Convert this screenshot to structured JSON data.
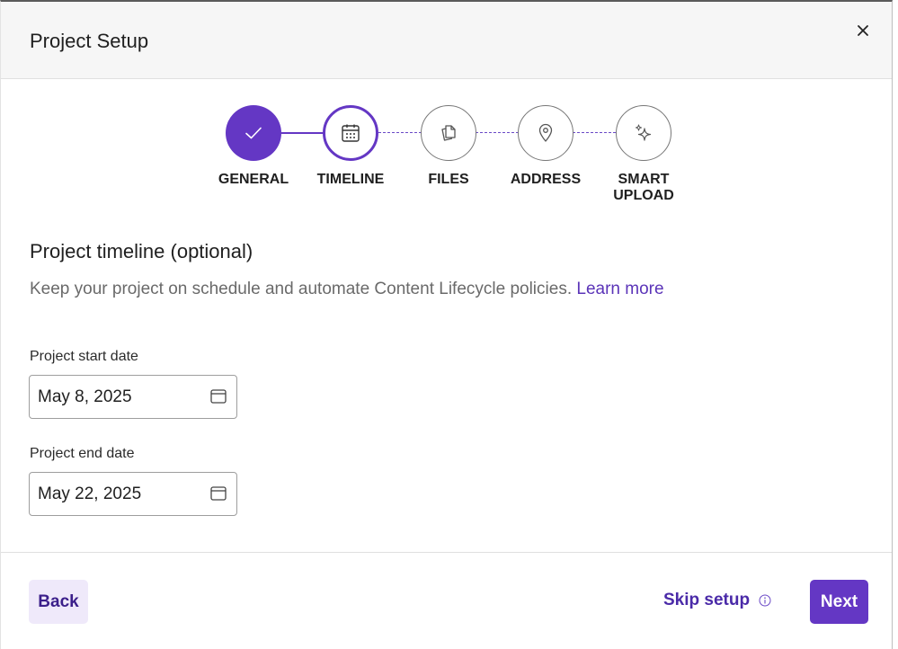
{
  "dialog": {
    "title": "Project Setup",
    "close_icon": "close-icon"
  },
  "stepper": {
    "current_step": 2,
    "steps": [
      {
        "label": "GENERAL",
        "state": "done",
        "icon": "check-icon"
      },
      {
        "label": "TIMELINE",
        "state": "active",
        "icon": "calendar-icon"
      },
      {
        "label": "FILES",
        "state": "todo",
        "icon": "files-icon"
      },
      {
        "label": "ADDRESS",
        "state": "todo",
        "icon": "location-pin-icon"
      },
      {
        "label": "SMART\nUPLOAD",
        "state": "todo",
        "icon": "sparkle-icon"
      }
    ]
  },
  "section": {
    "title": "Project timeline (optional)",
    "description": "Keep your project on schedule and automate Content Lifecycle policies. ",
    "learn_more": "Learn more"
  },
  "fields": {
    "start_date": {
      "label": "Project start date",
      "value": "May 8, 2025"
    },
    "end_date": {
      "label": "Project end date",
      "value": "May 22, 2025"
    }
  },
  "footer": {
    "back_label": "Back",
    "skip_label": "Skip setup",
    "next_label": "Next"
  },
  "colors": {
    "accent": "#6437c4",
    "accent_light": "#efe9fa",
    "link": "#5b34b8"
  }
}
